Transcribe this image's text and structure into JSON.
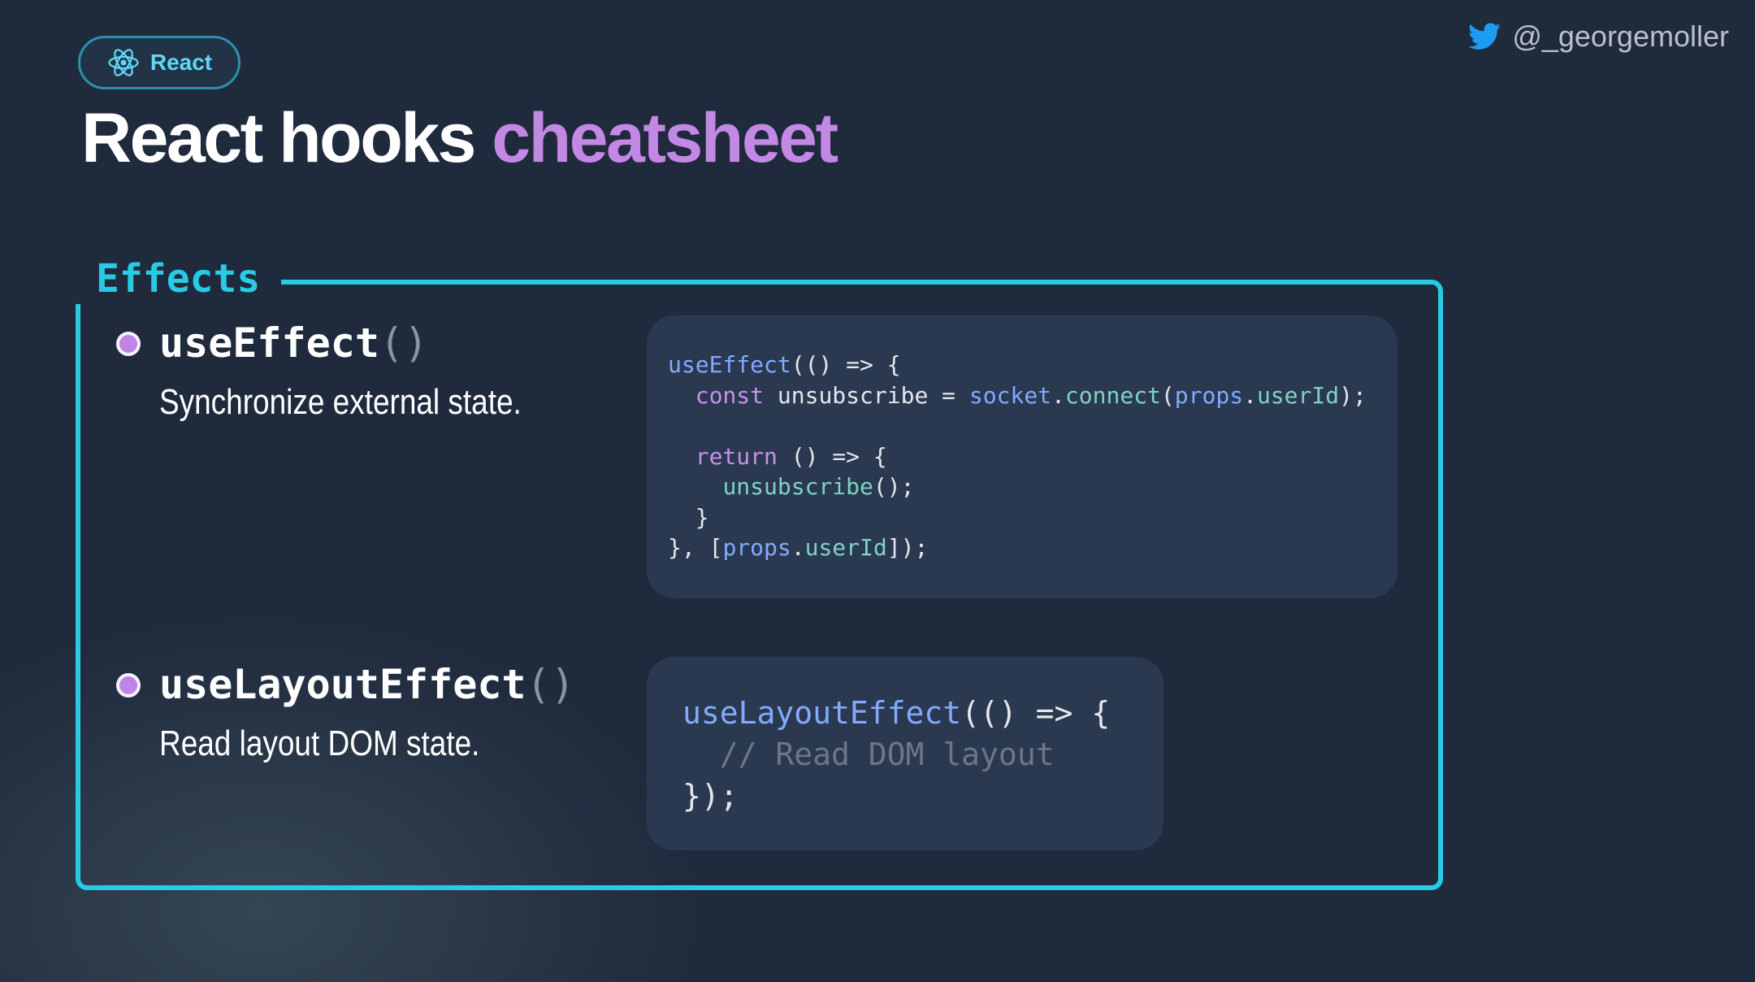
{
  "badge": {
    "label": "React",
    "icon": "react-atom-icon"
  },
  "twitter": {
    "handle": "@_georgemoller",
    "icon": "twitter-bird-icon"
  },
  "title": {
    "main": "React hooks",
    "accent": "cheatsheet"
  },
  "section": {
    "label": "Effects"
  },
  "hooks": [
    {
      "name": "useEffect",
      "parens": "()",
      "description": "Synchronize external state."
    },
    {
      "name": "useLayoutEffect",
      "parens": "()",
      "description": "Read layout DOM state."
    }
  ],
  "code": {
    "effect": {
      "l1_fn": "useEffect",
      "l1_rest": "(() => {",
      "l2_kw": "const",
      "l2_var": " unsubscribe = ",
      "l2_obj": "socket",
      "l2_dot": ".",
      "l2_method": "connect",
      "l2_open": "(",
      "l2_props": "props",
      "l2_dot2": ".",
      "l2_prop": "userId",
      "l2_close": ");",
      "l4_kw": "return",
      "l4_rest": " () => {",
      "l5_fn": "unsubscribe",
      "l5_rest": "();",
      "l6": "}",
      "l7_open": "}, [",
      "l7_props": "props",
      "l7_dot": ".",
      "l7_prop": "userId",
      "l7_close": "]);"
    },
    "layout": {
      "l1_fn": "useLayoutEffect",
      "l1_rest": "(() => {",
      "l2_comment": "// Read DOM layout",
      "l3": "});"
    }
  },
  "colors": {
    "background": "#1f2a3d",
    "accent_cyan": "#27cbe4",
    "accent_purple": "#c388e4",
    "code_panel": "#2a3850"
  }
}
